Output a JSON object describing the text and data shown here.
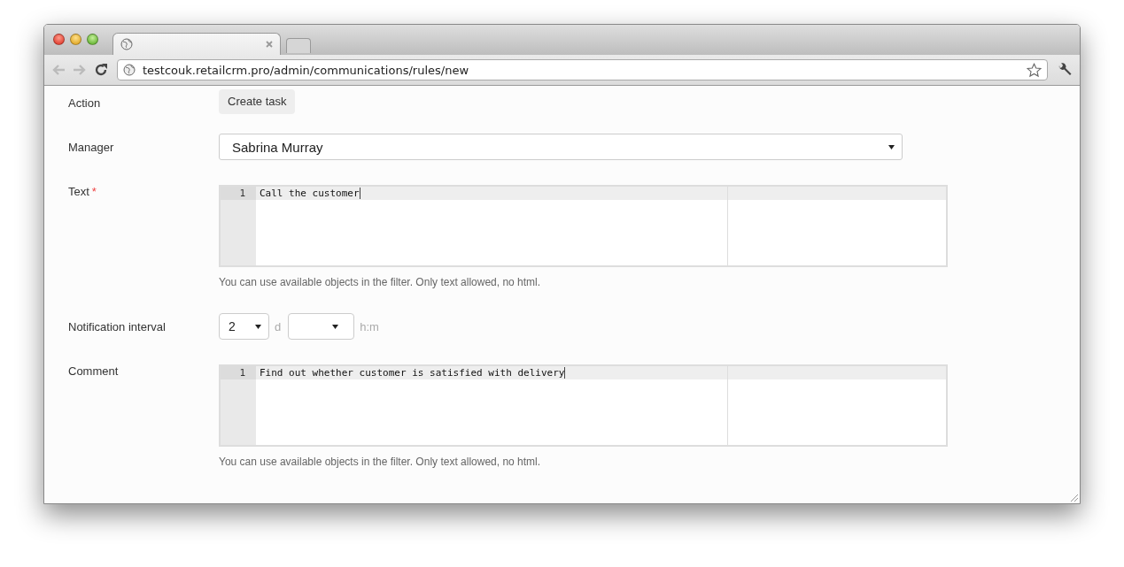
{
  "browser": {
    "tabs": [
      {
        "selected": true
      }
    ],
    "address": "testcouk.retailcrm.pro/admin/communications/rules/new",
    "bookmarked": false
  },
  "form": {
    "fields": [
      {
        "kind": "button",
        "label": "Action",
        "required": false,
        "value": "Create task"
      },
      {
        "kind": "select",
        "label": "Manager",
        "required": false,
        "value": "Sabrina Murray"
      },
      {
        "kind": "editor",
        "label": "Text",
        "required": true,
        "required_mark": "*",
        "lines": [
          {
            "number": "1",
            "text": "Call the customer"
          }
        ],
        "hint": "You can use available objects in the filter. Only text allowed, no html."
      },
      {
        "kind": "interval",
        "label": "Notification interval",
        "required": false,
        "parts": [
          {
            "value": "2",
            "unit": "d"
          },
          {
            "unit": "h:m"
          }
        ]
      },
      {
        "kind": "editor",
        "label": "Comment",
        "required": false,
        "lines": [
          {
            "number": "1",
            "text": "Find out whether customer is satisfied with delivery"
          }
        ],
        "hint": "You can use available objects in the filter. Only text allowed, no html."
      }
    ]
  }
}
